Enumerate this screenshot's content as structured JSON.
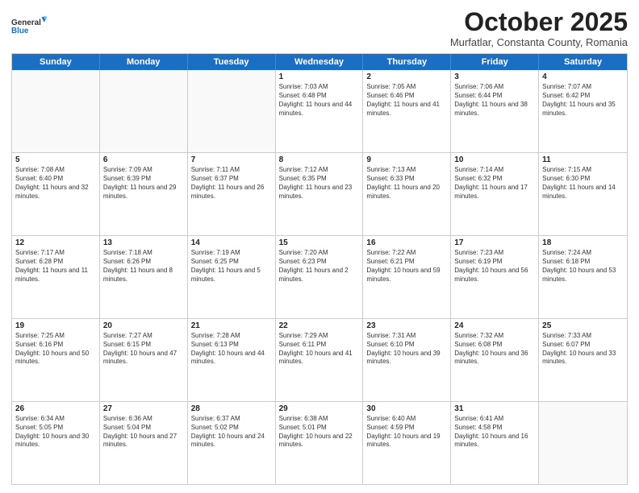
{
  "header": {
    "logo": {
      "general": "General",
      "blue": "Blue"
    },
    "title": "October 2025",
    "location": "Murfatlar, Constanta County, Romania"
  },
  "days_of_week": [
    "Sunday",
    "Monday",
    "Tuesday",
    "Wednesday",
    "Thursday",
    "Friday",
    "Saturday"
  ],
  "weeks": [
    [
      {
        "day": "",
        "empty": true
      },
      {
        "day": "",
        "empty": true
      },
      {
        "day": "",
        "empty": true
      },
      {
        "day": "1",
        "sunrise": "Sunrise: 7:03 AM",
        "sunset": "Sunset: 6:48 PM",
        "daylight": "Daylight: 11 hours and 44 minutes."
      },
      {
        "day": "2",
        "sunrise": "Sunrise: 7:05 AM",
        "sunset": "Sunset: 6:46 PM",
        "daylight": "Daylight: 11 hours and 41 minutes."
      },
      {
        "day": "3",
        "sunrise": "Sunrise: 7:06 AM",
        "sunset": "Sunset: 6:44 PM",
        "daylight": "Daylight: 11 hours and 38 minutes."
      },
      {
        "day": "4",
        "sunrise": "Sunrise: 7:07 AM",
        "sunset": "Sunset: 6:42 PM",
        "daylight": "Daylight: 11 hours and 35 minutes."
      }
    ],
    [
      {
        "day": "5",
        "sunrise": "Sunrise: 7:08 AM",
        "sunset": "Sunset: 6:40 PM",
        "daylight": "Daylight: 11 hours and 32 minutes."
      },
      {
        "day": "6",
        "sunrise": "Sunrise: 7:09 AM",
        "sunset": "Sunset: 6:39 PM",
        "daylight": "Daylight: 11 hours and 29 minutes."
      },
      {
        "day": "7",
        "sunrise": "Sunrise: 7:11 AM",
        "sunset": "Sunset: 6:37 PM",
        "daylight": "Daylight: 11 hours and 26 minutes."
      },
      {
        "day": "8",
        "sunrise": "Sunrise: 7:12 AM",
        "sunset": "Sunset: 6:35 PM",
        "daylight": "Daylight: 11 hours and 23 minutes."
      },
      {
        "day": "9",
        "sunrise": "Sunrise: 7:13 AM",
        "sunset": "Sunset: 6:33 PM",
        "daylight": "Daylight: 11 hours and 20 minutes."
      },
      {
        "day": "10",
        "sunrise": "Sunrise: 7:14 AM",
        "sunset": "Sunset: 6:32 PM",
        "daylight": "Daylight: 11 hours and 17 minutes."
      },
      {
        "day": "11",
        "sunrise": "Sunrise: 7:15 AM",
        "sunset": "Sunset: 6:30 PM",
        "daylight": "Daylight: 11 hours and 14 minutes."
      }
    ],
    [
      {
        "day": "12",
        "sunrise": "Sunrise: 7:17 AM",
        "sunset": "Sunset: 6:28 PM",
        "daylight": "Daylight: 11 hours and 11 minutes."
      },
      {
        "day": "13",
        "sunrise": "Sunrise: 7:18 AM",
        "sunset": "Sunset: 6:26 PM",
        "daylight": "Daylight: 11 hours and 8 minutes."
      },
      {
        "day": "14",
        "sunrise": "Sunrise: 7:19 AM",
        "sunset": "Sunset: 6:25 PM",
        "daylight": "Daylight: 11 hours and 5 minutes."
      },
      {
        "day": "15",
        "sunrise": "Sunrise: 7:20 AM",
        "sunset": "Sunset: 6:23 PM",
        "daylight": "Daylight: 11 hours and 2 minutes."
      },
      {
        "day": "16",
        "sunrise": "Sunrise: 7:22 AM",
        "sunset": "Sunset: 6:21 PM",
        "daylight": "Daylight: 10 hours and 59 minutes."
      },
      {
        "day": "17",
        "sunrise": "Sunrise: 7:23 AM",
        "sunset": "Sunset: 6:19 PM",
        "daylight": "Daylight: 10 hours and 56 minutes."
      },
      {
        "day": "18",
        "sunrise": "Sunrise: 7:24 AM",
        "sunset": "Sunset: 6:18 PM",
        "daylight": "Daylight: 10 hours and 53 minutes."
      }
    ],
    [
      {
        "day": "19",
        "sunrise": "Sunrise: 7:25 AM",
        "sunset": "Sunset: 6:16 PM",
        "daylight": "Daylight: 10 hours and 50 minutes."
      },
      {
        "day": "20",
        "sunrise": "Sunrise: 7:27 AM",
        "sunset": "Sunset: 6:15 PM",
        "daylight": "Daylight: 10 hours and 47 minutes."
      },
      {
        "day": "21",
        "sunrise": "Sunrise: 7:28 AM",
        "sunset": "Sunset: 6:13 PM",
        "daylight": "Daylight: 10 hours and 44 minutes."
      },
      {
        "day": "22",
        "sunrise": "Sunrise: 7:29 AM",
        "sunset": "Sunset: 6:11 PM",
        "daylight": "Daylight: 10 hours and 41 minutes."
      },
      {
        "day": "23",
        "sunrise": "Sunrise: 7:31 AM",
        "sunset": "Sunset: 6:10 PM",
        "daylight": "Daylight: 10 hours and 39 minutes."
      },
      {
        "day": "24",
        "sunrise": "Sunrise: 7:32 AM",
        "sunset": "Sunset: 6:08 PM",
        "daylight": "Daylight: 10 hours and 36 minutes."
      },
      {
        "day": "25",
        "sunrise": "Sunrise: 7:33 AM",
        "sunset": "Sunset: 6:07 PM",
        "daylight": "Daylight: 10 hours and 33 minutes."
      }
    ],
    [
      {
        "day": "26",
        "sunrise": "Sunrise: 6:34 AM",
        "sunset": "Sunset: 5:05 PM",
        "daylight": "Daylight: 10 hours and 30 minutes."
      },
      {
        "day": "27",
        "sunrise": "Sunrise: 6:36 AM",
        "sunset": "Sunset: 5:04 PM",
        "daylight": "Daylight: 10 hours and 27 minutes."
      },
      {
        "day": "28",
        "sunrise": "Sunrise: 6:37 AM",
        "sunset": "Sunset: 5:02 PM",
        "daylight": "Daylight: 10 hours and 24 minutes."
      },
      {
        "day": "29",
        "sunrise": "Sunrise: 6:38 AM",
        "sunset": "Sunset: 5:01 PM",
        "daylight": "Daylight: 10 hours and 22 minutes."
      },
      {
        "day": "30",
        "sunrise": "Sunrise: 6:40 AM",
        "sunset": "Sunset: 4:59 PM",
        "daylight": "Daylight: 10 hours and 19 minutes."
      },
      {
        "day": "31",
        "sunrise": "Sunrise: 6:41 AM",
        "sunset": "Sunset: 4:58 PM",
        "daylight": "Daylight: 10 hours and 16 minutes."
      },
      {
        "day": "",
        "empty": true
      }
    ]
  ]
}
